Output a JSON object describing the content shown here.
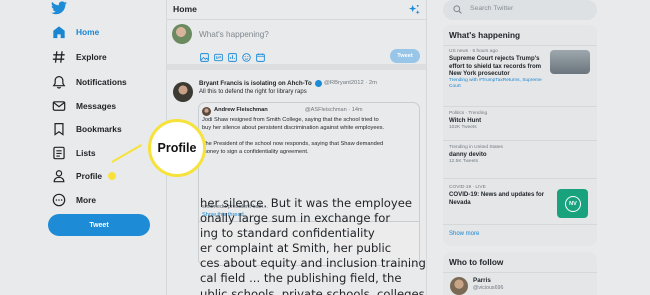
{
  "sidebar": {
    "items": [
      {
        "label": "Home",
        "icon": "home-icon"
      },
      {
        "label": "Explore",
        "icon": "hashtag-icon"
      },
      {
        "label": "Notifications",
        "icon": "bell-icon"
      },
      {
        "label": "Messages",
        "icon": "envelope-icon"
      },
      {
        "label": "Bookmarks",
        "icon": "bookmark-icon"
      },
      {
        "label": "Lists",
        "icon": "list-icon"
      },
      {
        "label": "Profile",
        "icon": "person-icon"
      },
      {
        "label": "More",
        "icon": "more-icon"
      }
    ],
    "tweet_button": "Tweet"
  },
  "main": {
    "title": "Home",
    "composer": {
      "placeholder": "What's happening?",
      "tweet_button": "Tweet"
    },
    "post": {
      "author": "Bryant Francis is isolating on Ahch-To",
      "handle": "@RBryant2012 · 2m",
      "text": "All this to defend the right for library raps",
      "quote": {
        "author": "Andrew Fleischman",
        "handle": "@ASFleischman · 14m",
        "lines": [
          "Jodi Shaw resigned from Smith College, saying that the school tried to",
          "buy her silence about persistent discrimination against white employees.",
          "The President of the school now responds, saying that Shaw demanded",
          "money to sign a confidentiality agreement."
        ],
        "link": "smith.edu/president-kath...",
        "show_thread": "Show this thread"
      },
      "article_lines": [
        "her silence. But it was the employee",
        "onally large sum in exchange for",
        "ing to standard confidentiality",
        "er complaint at Smith, her public",
        "ces about equity and inclusion training",
        "cal field ... the publishing field, the",
        "ublic schools, private schools, colleges"
      ]
    }
  },
  "right": {
    "search_placeholder": "Search Twitter",
    "whats_happening": {
      "title": "What's happening",
      "trends": [
        {
          "meta": "US news · 5 hours ago",
          "title": "Supreme Court rejects Trump's effort to shield tax records from New York prosecutor",
          "tag": "Trending with #TrumpTaxReturns, Supreme Court",
          "count": ""
        },
        {
          "meta": "Politics · Trending",
          "title": "Witch Hunt",
          "tag": "",
          "count": "102K Tweets"
        },
        {
          "meta": "Trending in United States",
          "title": "danny devito",
          "tag": "",
          "count": "12.5K Tweets"
        },
        {
          "meta": "COVID-19 · LIVE",
          "title": "COVID-19: News and updates for Nevada",
          "tag": "",
          "count": ""
        }
      ],
      "nv_badge": "NV",
      "show_more": "Show more"
    },
    "who_to_follow": {
      "title": "Who to follow",
      "name": "Parris",
      "handle": "@vicious696"
    }
  },
  "callout": {
    "label": "Profile"
  },
  "colors": {
    "accent": "#1d8bd6",
    "callout": "#f6e23a",
    "background": "#e9eaeb"
  }
}
